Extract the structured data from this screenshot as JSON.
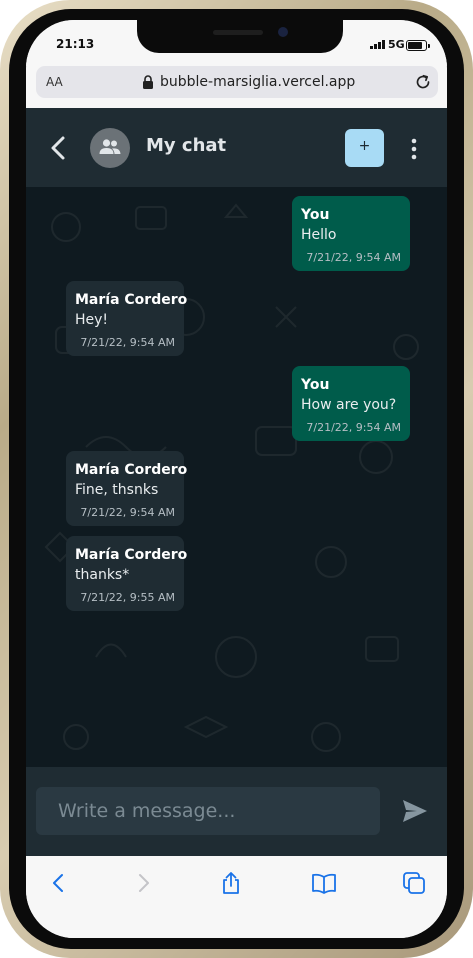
{
  "status_bar": {
    "time": "21:13",
    "network": "5G"
  },
  "browser": {
    "text_size_label": "AA",
    "url": "bubble-marsiglia.vercel.app"
  },
  "chat_header": {
    "title": "My chat",
    "add_button_label": "+"
  },
  "messages": [
    {
      "sender": "You",
      "text": "Hello",
      "timestamp": "7/21/22, 9:54 AM",
      "direction": "out"
    },
    {
      "sender": "María Cordero",
      "text": "Hey!",
      "timestamp": "7/21/22, 9:54 AM",
      "direction": "in"
    },
    {
      "sender": "You",
      "text": "How are you?",
      "timestamp": "7/21/22, 9:54 AM",
      "direction": "out"
    },
    {
      "sender": "María Cordero",
      "text": "Fine, thsnks",
      "timestamp": "7/21/22, 9:54 AM",
      "direction": "in"
    },
    {
      "sender": "María Cordero",
      "text": "thanks*",
      "timestamp": "7/21/22, 9:55 AM",
      "direction": "in"
    }
  ],
  "composer": {
    "placeholder": "Write a message..."
  },
  "icons": {
    "back": "chevron-left-icon",
    "avatar": "group-icon",
    "menu": "vertical-dots-icon",
    "send": "send-icon",
    "toolbar": [
      "browser-back-icon",
      "browser-forward-icon",
      "share-icon",
      "bookmarks-icon",
      "tabs-icon"
    ]
  },
  "colors": {
    "header": "#1f2c33",
    "chat_background": "#0f1a20",
    "outgoing_bubble": "#005c4b",
    "incoming_bubble": "#1f2c33",
    "add_button": "#a8dbf5",
    "browser_accent": "#1a73e8"
  }
}
